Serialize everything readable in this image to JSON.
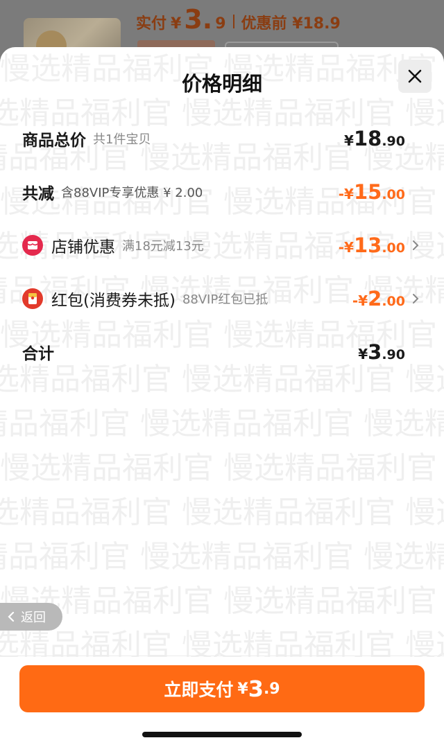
{
  "background": {
    "price_label": "实付",
    "currency": "¥",
    "price_int": "3.",
    "price_dec": "9",
    "orig_label": "优惠前 ¥18.9"
  },
  "sheet": {
    "title": "价格明细",
    "close_icon": "close-icon",
    "watermark": "慢选精品福利官"
  },
  "rows": {
    "total_goods": {
      "label": "商品总价",
      "sub": "共1件宝贝",
      "cur": "¥",
      "int": "18",
      "dec": ".90"
    },
    "discount": {
      "label": "共减",
      "sub": "含88VIP专享优惠 ¥ 2.00",
      "cur": "-¥",
      "int": "15",
      "dec": ".00"
    },
    "shop_discount": {
      "label": "店铺优惠",
      "sub": "满18元减13元",
      "cur": "-¥",
      "int": "13",
      "dec": ".00",
      "icon": "shop-icon"
    },
    "red_packet": {
      "label": "红包(消费券未抵)",
      "sub": "88VIP红包已抵",
      "cur": "-¥",
      "int": "2",
      "dec": ".00",
      "icon": "red-packet-icon"
    },
    "sum": {
      "label": "合计",
      "cur": "¥",
      "int": "3",
      "dec": ".90"
    }
  },
  "back": {
    "label": "返回"
  },
  "pay": {
    "label": "立即支付",
    "cur": "¥",
    "int": "3",
    "dec": ".9"
  },
  "colors": {
    "accent": "#ff6a14",
    "discount": "#ff6a1a"
  }
}
